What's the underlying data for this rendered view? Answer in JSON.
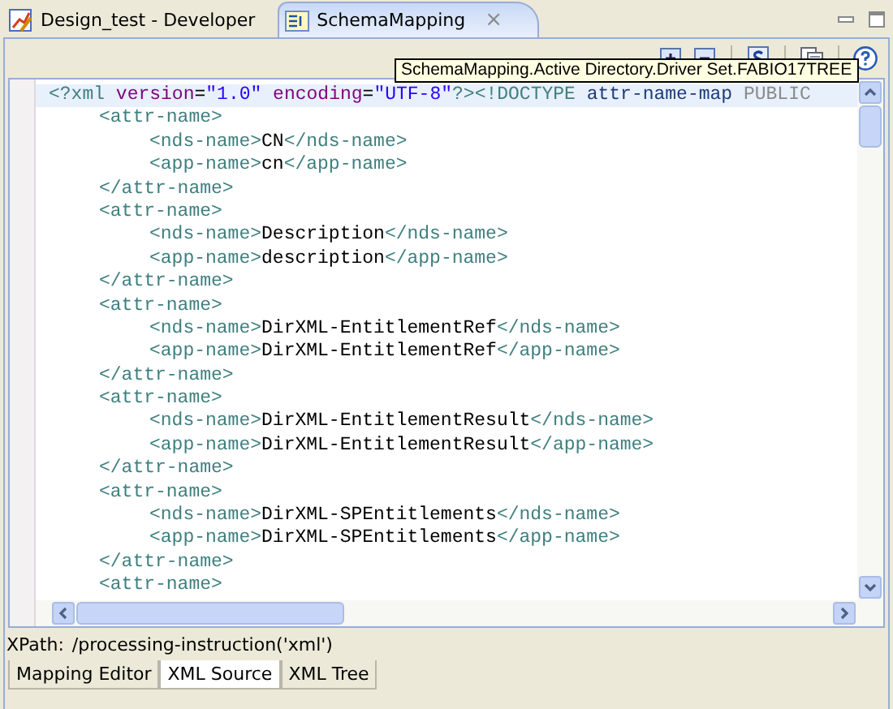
{
  "editor_tabs": [
    {
      "label": "Design_test - Developer",
      "selected": false,
      "closable": false
    },
    {
      "label": "SchemaMapping",
      "selected": true,
      "closable": true,
      "close_glyph": "×"
    }
  ],
  "tooltip": "SchemaMapping.Active Directory.Driver Set.FABIO17TREE",
  "source": [
    {
      "tokens": [
        {
          "kind": "tag",
          "text": "<?xml"
        },
        {
          "kind": "attr",
          "text": " version"
        },
        {
          "kind": "punct",
          "text": "="
        },
        {
          "kind": "value",
          "text": "\"1.0\""
        },
        {
          "kind": "attr",
          "text": " encoding"
        },
        {
          "kind": "punct",
          "text": "="
        },
        {
          "kind": "value",
          "text": "\"UTF-8\""
        },
        {
          "kind": "tag",
          "text": "?>"
        },
        {
          "kind": "tag",
          "text": "<!DOCTYPE"
        },
        {
          "kind": "name",
          "text": " attr-name-map"
        },
        {
          "kind": "keyword",
          "text": " PUBLIC"
        }
      ],
      "children": [
        {
          "tokens": [
            {
              "kind": "tag",
              "text": "<attr-name>"
            }
          ],
          "children": [
            {
              "tokens": [
                {
                  "kind": "tag",
                  "text": "<nds-name>"
                },
                {
                  "kind": "text",
                  "text": "CN"
                },
                {
                  "kind": "tag",
                  "text": "</nds-name>"
                }
              ]
            },
            {
              "tokens": [
                {
                  "kind": "tag",
                  "text": "<app-name>"
                },
                {
                  "kind": "text",
                  "text": "cn"
                },
                {
                  "kind": "tag",
                  "text": "</app-name>"
                }
              ]
            }
          ]
        },
        {
          "tokens": [
            {
              "kind": "tag",
              "text": "</attr-name>"
            }
          ]
        },
        {
          "tokens": [
            {
              "kind": "tag",
              "text": "<attr-name>"
            }
          ],
          "children": [
            {
              "tokens": [
                {
                  "kind": "tag",
                  "text": "<nds-name>"
                },
                {
                  "kind": "text",
                  "text": "Description"
                },
                {
                  "kind": "tag",
                  "text": "</nds-name>"
                }
              ]
            },
            {
              "tokens": [
                {
                  "kind": "tag",
                  "text": "<app-name>"
                },
                {
                  "kind": "text",
                  "text": "description"
                },
                {
                  "kind": "tag",
                  "text": "</app-name>"
                }
              ]
            }
          ]
        },
        {
          "tokens": [
            {
              "kind": "tag",
              "text": "</attr-name>"
            }
          ]
        },
        {
          "tokens": [
            {
              "kind": "tag",
              "text": "<attr-name>"
            }
          ],
          "children": [
            {
              "tokens": [
                {
                  "kind": "tag",
                  "text": "<nds-name>"
                },
                {
                  "kind": "text",
                  "text": "DirXML-EntitlementRef"
                },
                {
                  "kind": "tag",
                  "text": "</nds-name>"
                }
              ]
            },
            {
              "tokens": [
                {
                  "kind": "tag",
                  "text": "<app-name>"
                },
                {
                  "kind": "text",
                  "text": "DirXML-EntitlementRef"
                },
                {
                  "kind": "tag",
                  "text": "</app-name>"
                }
              ]
            }
          ]
        },
        {
          "tokens": [
            {
              "kind": "tag",
              "text": "</attr-name>"
            }
          ]
        },
        {
          "tokens": [
            {
              "kind": "tag",
              "text": "<attr-name>"
            }
          ],
          "children": [
            {
              "tokens": [
                {
                  "kind": "tag",
                  "text": "<nds-name>"
                },
                {
                  "kind": "text",
                  "text": "DirXML-EntitlementResult"
                },
                {
                  "kind": "tag",
                  "text": "</nds-name>"
                }
              ]
            },
            {
              "tokens": [
                {
                  "kind": "tag",
                  "text": "<app-name>"
                },
                {
                  "kind": "text",
                  "text": "DirXML-EntitlementResult"
                },
                {
                  "kind": "tag",
                  "text": "</app-name>"
                }
              ]
            }
          ]
        },
        {
          "tokens": [
            {
              "kind": "tag",
              "text": "</attr-name>"
            }
          ]
        },
        {
          "tokens": [
            {
              "kind": "tag",
              "text": "<attr-name>"
            }
          ],
          "children": [
            {
              "tokens": [
                {
                  "kind": "tag",
                  "text": "<nds-name>"
                },
                {
                  "kind": "text",
                  "text": "DirXML-SPEntitlements"
                },
                {
                  "kind": "tag",
                  "text": "</nds-name>"
                }
              ]
            },
            {
              "tokens": [
                {
                  "kind": "tag",
                  "text": "<app-name>"
                },
                {
                  "kind": "text",
                  "text": "DirXML-SPEntitlements"
                },
                {
                  "kind": "tag",
                  "text": "</app-name>"
                }
              ]
            }
          ]
        },
        {
          "tokens": [
            {
              "kind": "tag",
              "text": "</attr-name>"
            }
          ]
        },
        {
          "tokens": [
            {
              "kind": "tag",
              "text": "<attr-name>"
            }
          ]
        }
      ]
    }
  ],
  "xpath": {
    "label": "XPath:",
    "value": "/processing-instruction('xml')"
  },
  "page_tabs": [
    {
      "label": "Mapping Editor",
      "selected": false
    },
    {
      "label": "XML Source",
      "selected": true
    },
    {
      "label": "XML Tree",
      "selected": false
    }
  ]
}
